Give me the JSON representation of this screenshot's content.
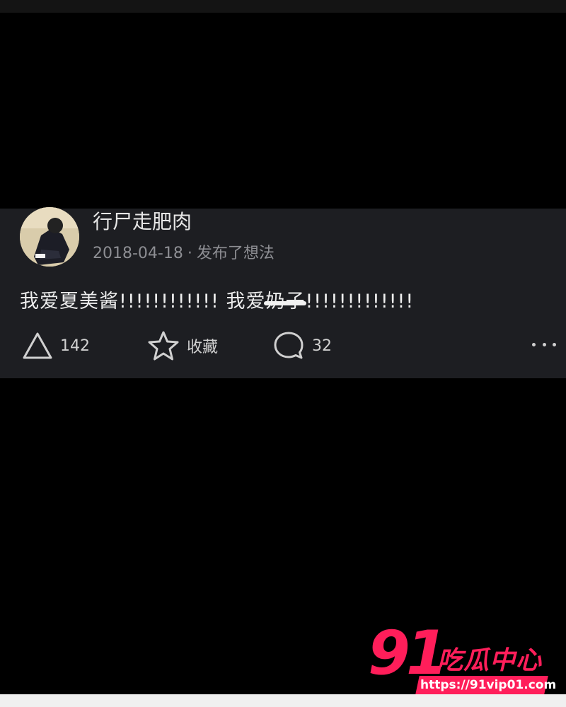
{
  "post": {
    "username": "行尸走肥肉",
    "date": "2018-04-18",
    "separator": "·",
    "action_text": "发布了想法",
    "text_part1": "我爱夏美酱!!!!!!!!!!!! 我爱",
    "text_blurred": "奶子",
    "text_part2": "!!!!!!!!!!!!!"
  },
  "actions": {
    "like_count": "142",
    "favorite_label": "收藏",
    "comment_count": "32"
  },
  "watermark": {
    "number": "91",
    "title": "吃瓜中心",
    "url": "https://91vip01.com"
  },
  "colors": {
    "background": "#000000",
    "card": "#1d1e22",
    "accent": "#ff1e5a"
  },
  "icons": [
    "like-triangle-icon",
    "star-icon",
    "comment-bubble-icon",
    "more-dots-icon"
  ]
}
